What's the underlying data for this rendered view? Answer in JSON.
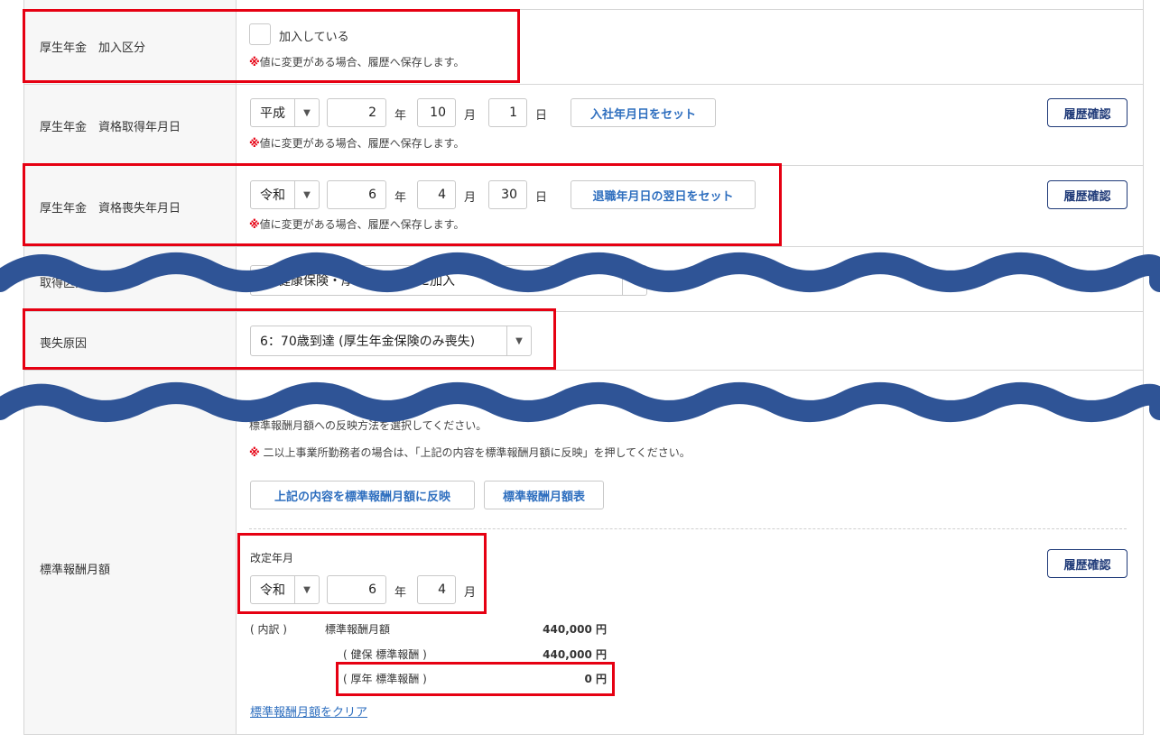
{
  "rows": {
    "kounen_kanyu": {
      "label": "厚生年金　加入区分",
      "checkbox_label": "加入している",
      "note_mark": "※",
      "note": "値に変更がある場合、履歴へ保存します。"
    },
    "shikaku_shutoku": {
      "label": "厚生年金　資格取得年月日",
      "era": "平成",
      "year": "2",
      "month": "10",
      "day": "1",
      "unit_year": "年",
      "unit_month": "月",
      "unit_day": "日",
      "set_button": "入社年月日をセット",
      "history_button": "履歴確認",
      "note_mark": "※",
      "note": "値に変更がある場合、履歴へ保存します。"
    },
    "shikaku_soushitsu": {
      "label": "厚生年金　資格喪失年月日",
      "era": "令和",
      "year": "6",
      "month": "4",
      "day": "30",
      "unit_year": "年",
      "unit_month": "月",
      "unit_day": "日",
      "set_button": "退職年月日の翌日をセット",
      "history_button": "履歴確認",
      "note_mark": "※",
      "note": "値に変更がある場合、履歴へ保存します。"
    },
    "shutoku_kubun": {
      "label": "取得区分",
      "value": "健康保険・厚生年金保険に加入"
    },
    "soushitsu_genin": {
      "label": "喪失原因",
      "value": "6：70歳到達 (厚生年金保険のみ喪失)"
    },
    "hyoujun": {
      "label": "標準報酬月額",
      "intro": "標準報酬月額への反映方法を選択してください。",
      "note_mark": "※",
      "note": "二以上事業所勤務者の場合は、「上記の内容を標準報酬月額に反映」を押してください。",
      "reflect_button": "上記の内容を標準報酬月額に反映",
      "table_button": "標準報酬月額表",
      "kaitei_label": "改定年月",
      "era": "令和",
      "year": "6",
      "month": "4",
      "unit_year": "年",
      "unit_month": "月",
      "history_button": "履歴確認",
      "breakdown": {
        "prefix": "( 内訳 )",
        "total_label": "標準報酬月額",
        "total_value": "440,000 円",
        "kenpo_label": "( 健保 標準報酬 )",
        "kenpo_value": "440,000 円",
        "kounen_label": "( 厚年 標準報酬 )",
        "kounen_value": "0 円"
      },
      "clear_link": "標準報酬月額をクリア"
    }
  },
  "colors": {
    "highlight": "#e60012",
    "wave": "#2f5496",
    "link": "#2f6fbf",
    "history_button": "#1f3a78"
  }
}
